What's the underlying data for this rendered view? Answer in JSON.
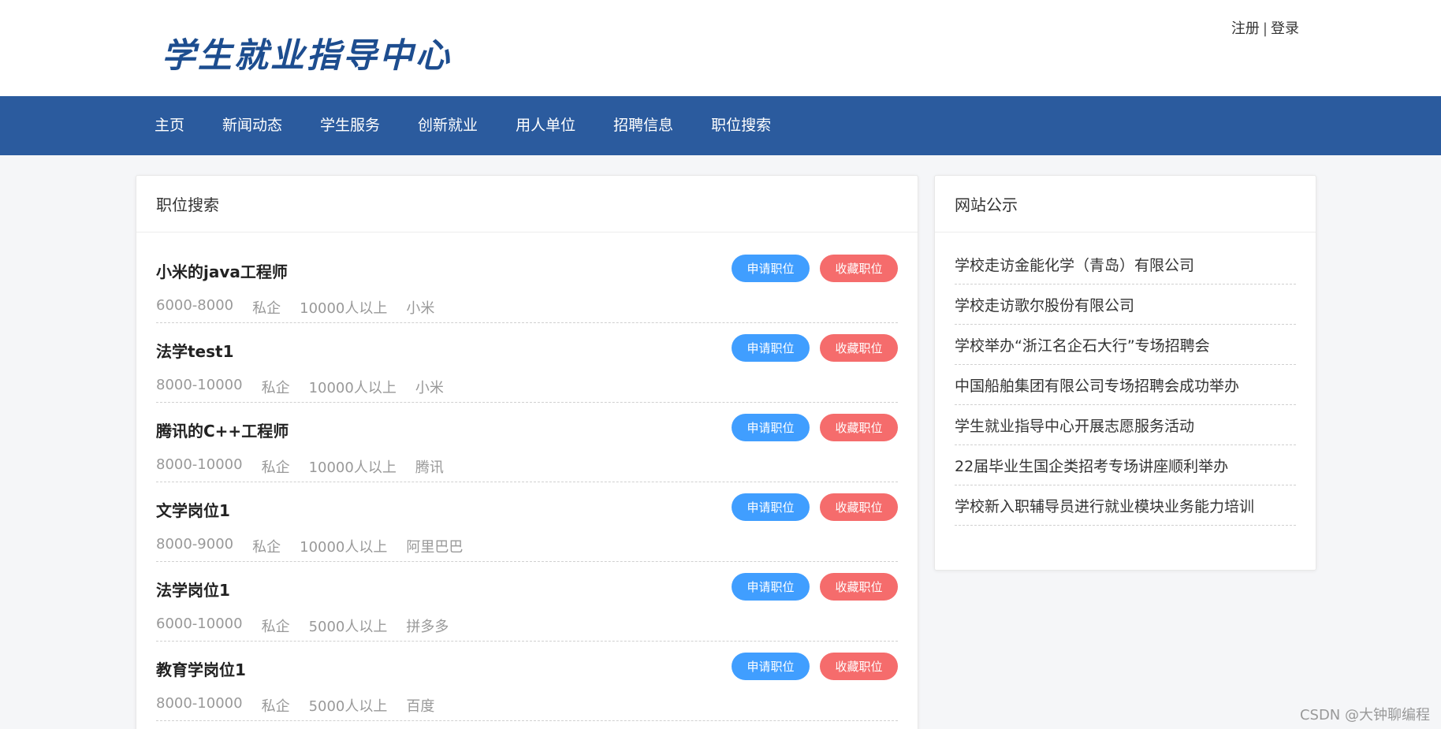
{
  "header": {
    "logo_text": "学生就业指导中心",
    "register_label": "注册",
    "separator": "|",
    "login_label": "登录"
  },
  "nav": {
    "items": [
      {
        "label": "主页"
      },
      {
        "label": "新闻动态"
      },
      {
        "label": "学生服务"
      },
      {
        "label": "创新就业"
      },
      {
        "label": "用人单位"
      },
      {
        "label": "招聘信息"
      },
      {
        "label": "职位搜索"
      }
    ]
  },
  "job_panel": {
    "title": "职位搜索",
    "apply_label": "申请职位",
    "favorite_label": "收藏职位",
    "jobs": [
      {
        "title": "小米的java工程师",
        "salary": "6000-8000",
        "type": "私企",
        "size": "10000人以上",
        "company": "小米"
      },
      {
        "title": "法学test1",
        "salary": "8000-10000",
        "type": "私企",
        "size": "10000人以上",
        "company": "小米"
      },
      {
        "title": "腾讯的C++工程师",
        "salary": "8000-10000",
        "type": "私企",
        "size": "10000人以上",
        "company": "腾讯"
      },
      {
        "title": "文学岗位1",
        "salary": "8000-9000",
        "type": "私企",
        "size": "10000人以上",
        "company": "阿里巴巴"
      },
      {
        "title": "法学岗位1",
        "salary": "6000-10000",
        "type": "私企",
        "size": "5000人以上",
        "company": "拼多多"
      },
      {
        "title": "教育学岗位1",
        "salary": "8000-10000",
        "type": "私企",
        "size": "5000人以上",
        "company": "百度"
      }
    ]
  },
  "notice_panel": {
    "title": "网站公示",
    "items": [
      {
        "text": "学校走访金能化学（青岛）有限公司"
      },
      {
        "text": "学校走访歌尔股份有限公司"
      },
      {
        "text": "学校举办“浙江名企石大行”专场招聘会"
      },
      {
        "text": "中国船舶集团有限公司专场招聘会成功举办"
      },
      {
        "text": "学生就业指导中心开展志愿服务活动"
      },
      {
        "text": "22届毕业生国企类招考专场讲座顺利举办"
      },
      {
        "text": "学校新入职辅导员进行就业模块业务能力培训"
      }
    ]
  },
  "watermark": "CSDN @大钟聊编程",
  "colors": {
    "nav_bg": "#2b5b9e",
    "logo": "#1d4d8f",
    "apply_button": "#409eff",
    "favorite_button": "#f56c6c"
  }
}
